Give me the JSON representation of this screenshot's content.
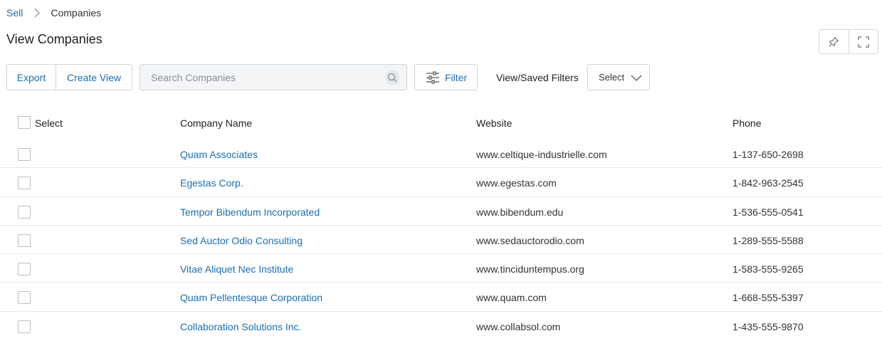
{
  "breadcrumb": {
    "root": "Sell",
    "current": "Companies"
  },
  "page_title": "View Companies",
  "toolbar": {
    "export_label": "Export",
    "create_view_label": "Create View"
  },
  "search": {
    "placeholder": "Search Companies",
    "value": ""
  },
  "filter": {
    "label": "Filter"
  },
  "saved_filters": {
    "label": "View/Saved Filters",
    "selected": "Select"
  },
  "table": {
    "headers": {
      "select": "Select",
      "company_name": "Company Name",
      "website": "Website",
      "phone": "Phone"
    },
    "rows": [
      {
        "company_name": "Quam Associates",
        "website": "www.celtique-industrielle.com",
        "phone": "1-137-650-2698"
      },
      {
        "company_name": "Egestas Corp.",
        "website": "www.egestas.com",
        "phone": "1-842-963-2545"
      },
      {
        "company_name": "Tempor Bibendum Incorporated",
        "website": "www.bibendum.edu",
        "phone": "1-536-555-0541"
      },
      {
        "company_name": "Sed Auctor Odio Consulting",
        "website": "www.sedauctorodio.com",
        "phone": "1-289-555-5588"
      },
      {
        "company_name": "Vitae Aliquet Nec Institute",
        "website": "www.tinciduntempus.org",
        "phone": "1-583-555-9265"
      },
      {
        "company_name": "Quam Pellentesque Corporation",
        "website": "www.quam.com",
        "phone": "1-668-555-5397"
      },
      {
        "company_name": "Collaboration Solutions Inc.",
        "website": "www.collabsol.com",
        "phone": "1-435-555-9870"
      }
    ]
  },
  "colors": {
    "link": "#1a6fb3",
    "border": "#d0d5da",
    "row_divider": "#e4e6e9"
  }
}
